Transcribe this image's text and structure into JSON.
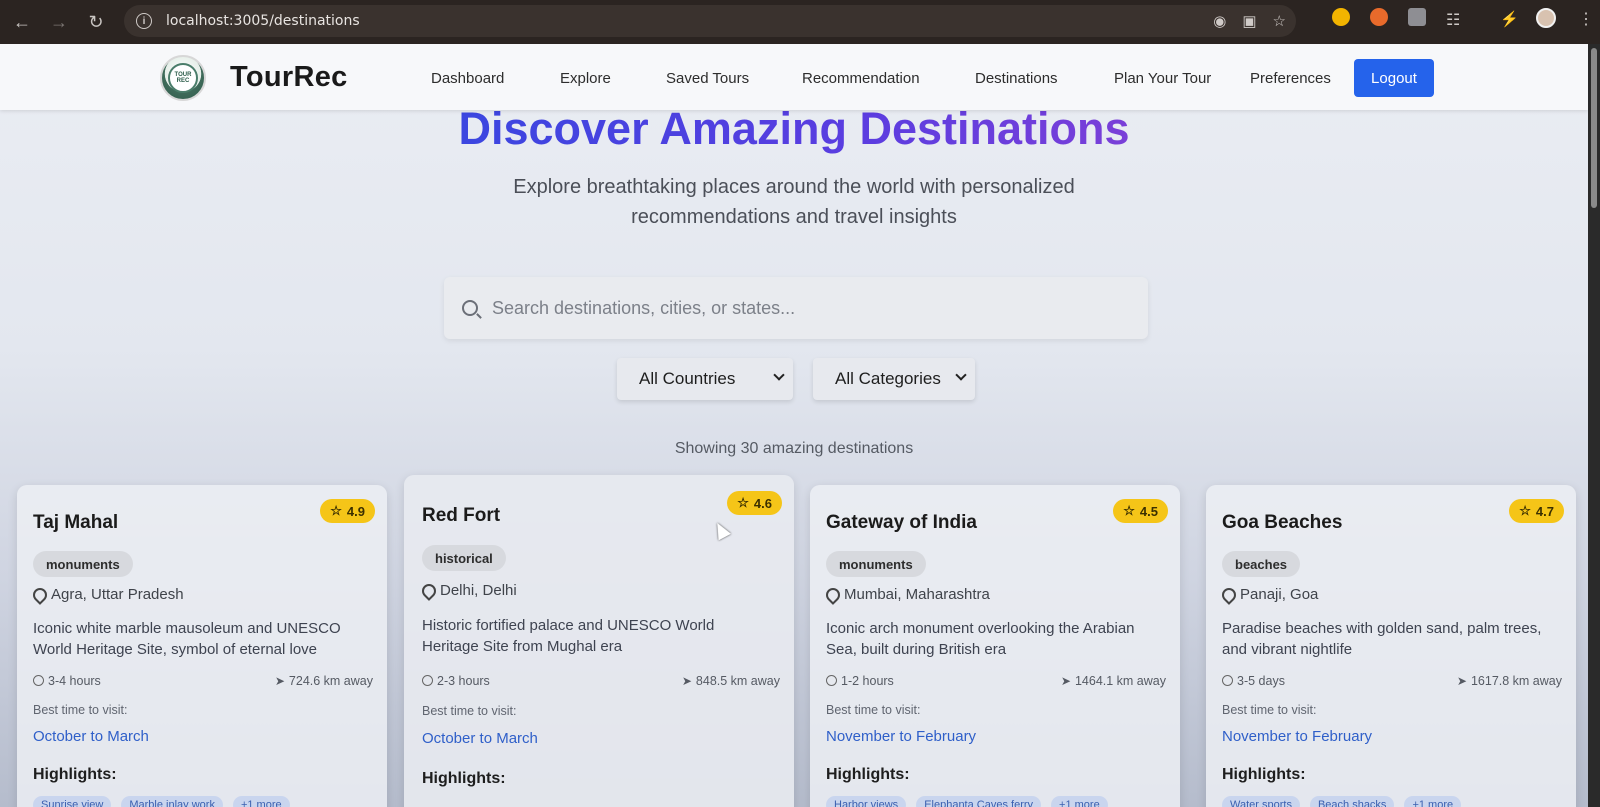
{
  "browser": {
    "url": "localhost:3005/destinations"
  },
  "nav": {
    "brand": "TourRec",
    "logo_text": "TOUR REC",
    "items": [
      "Dashboard",
      "Explore",
      "Saved Tours",
      "Recommendation",
      "Destinations",
      "Plan Your Tour",
      "Preferences"
    ],
    "logout": "Logout"
  },
  "hero": {
    "title": "Discover Amazing Destinations",
    "subtitle": "Explore breathtaking places around the world with personalized recommendations and travel insights"
  },
  "search": {
    "placeholder": "Search destinations, cities, or states..."
  },
  "filters": {
    "country": "All Countries",
    "category": "All Categories"
  },
  "results": {
    "count_text": "Showing 30 amazing destinations"
  },
  "cards": [
    {
      "title": "Taj Mahal",
      "rating": "4.9",
      "category": "monuments",
      "location": "Agra, Uttar Pradesh",
      "description": "Iconic white marble mausoleum and UNESCO World Heritage Site, symbol of eternal love",
      "duration": "3-4 hours",
      "distance": "724.6 km away",
      "best_time_label": "Best time to visit:",
      "best_time": "October to March",
      "highlights_label": "Highlights:",
      "highlights": [
        "Sunrise view",
        "Marble inlay work",
        "+1 more"
      ]
    },
    {
      "title": "Red Fort",
      "rating": "4.6",
      "category": "historical",
      "location": "Delhi, Delhi",
      "description": "Historic fortified palace and UNESCO World Heritage Site from Mughal era",
      "duration": "2-3 hours",
      "distance": "848.5 km away",
      "best_time_label": "Best time to visit:",
      "best_time": "October to March",
      "highlights_label": "Highlights:",
      "highlights": []
    },
    {
      "title": "Gateway of India",
      "rating": "4.5",
      "category": "monuments",
      "location": "Mumbai, Maharashtra",
      "description": "Iconic arch monument overlooking the Arabian Sea, built during British era",
      "duration": "1-2 hours",
      "distance": "1464.1 km away",
      "best_time_label": "Best time to visit:",
      "best_time": "November to February",
      "highlights_label": "Highlights:",
      "highlights": [
        "Harbor views",
        "Elephanta Caves ferry",
        "+1 more"
      ]
    },
    {
      "title": "Goa Beaches",
      "rating": "4.7",
      "category": "beaches",
      "location": "Panaji, Goa",
      "description": "Paradise beaches with golden sand, palm trees, and vibrant nightlife",
      "duration": "3-5 days",
      "distance": "1617.8 km away",
      "best_time_label": "Best time to visit:",
      "best_time": "November to February",
      "highlights_label": "Highlights:",
      "highlights": [
        "Water sports",
        "Beach shacks",
        "+1 more"
      ]
    }
  ]
}
